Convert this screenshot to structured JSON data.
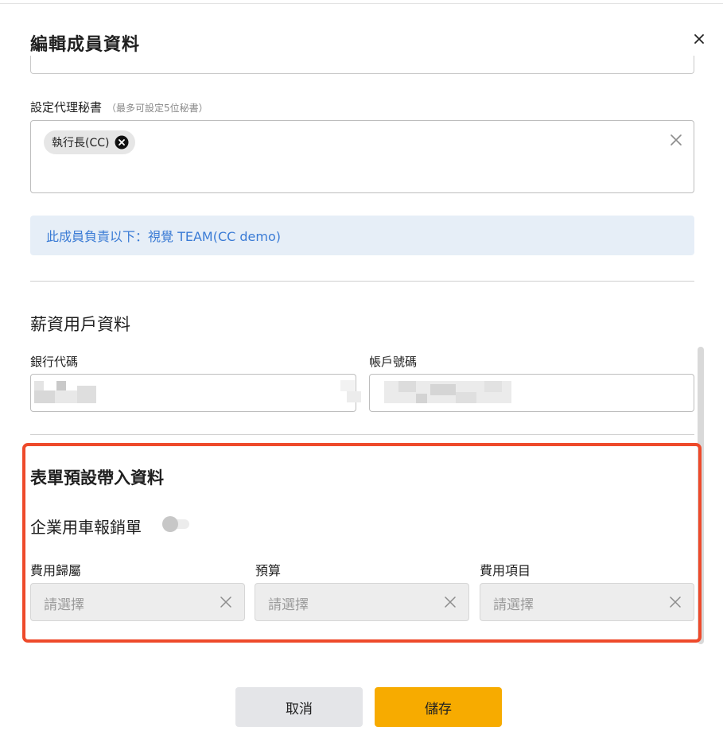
{
  "modal": {
    "title": "編輯成員資料"
  },
  "proxy": {
    "label": "設定代理秘書",
    "hint": "（最多可設定5位秘書）",
    "tags": [
      "執行長(CC)"
    ]
  },
  "info": {
    "text": "此成員負責以下：視覺 TEAM(CC demo)"
  },
  "salary": {
    "title": "薪資用戶資料",
    "bank_code_label": "銀行代碼",
    "account_label": "帳戶號碼"
  },
  "form_defaults": {
    "title": "表單預設帶入資料",
    "toggle_label": "企業用車報銷單",
    "toggle_on": false,
    "fields": [
      {
        "label": "費用歸屬",
        "placeholder": "請選擇"
      },
      {
        "label": "預算",
        "placeholder": "請選擇"
      },
      {
        "label": "費用項目",
        "placeholder": "請選擇"
      }
    ]
  },
  "buttons": {
    "cancel": "取消",
    "save": "儲存"
  },
  "colors": {
    "accent": "#f7ab00",
    "info_text": "#3a7bd5",
    "info_bg": "#e6eef7",
    "highlight_frame": "#ee4a2b"
  },
  "icons": {
    "close": "close-icon",
    "tag_remove": "circle-x-icon",
    "clear": "clear-x-icon"
  }
}
